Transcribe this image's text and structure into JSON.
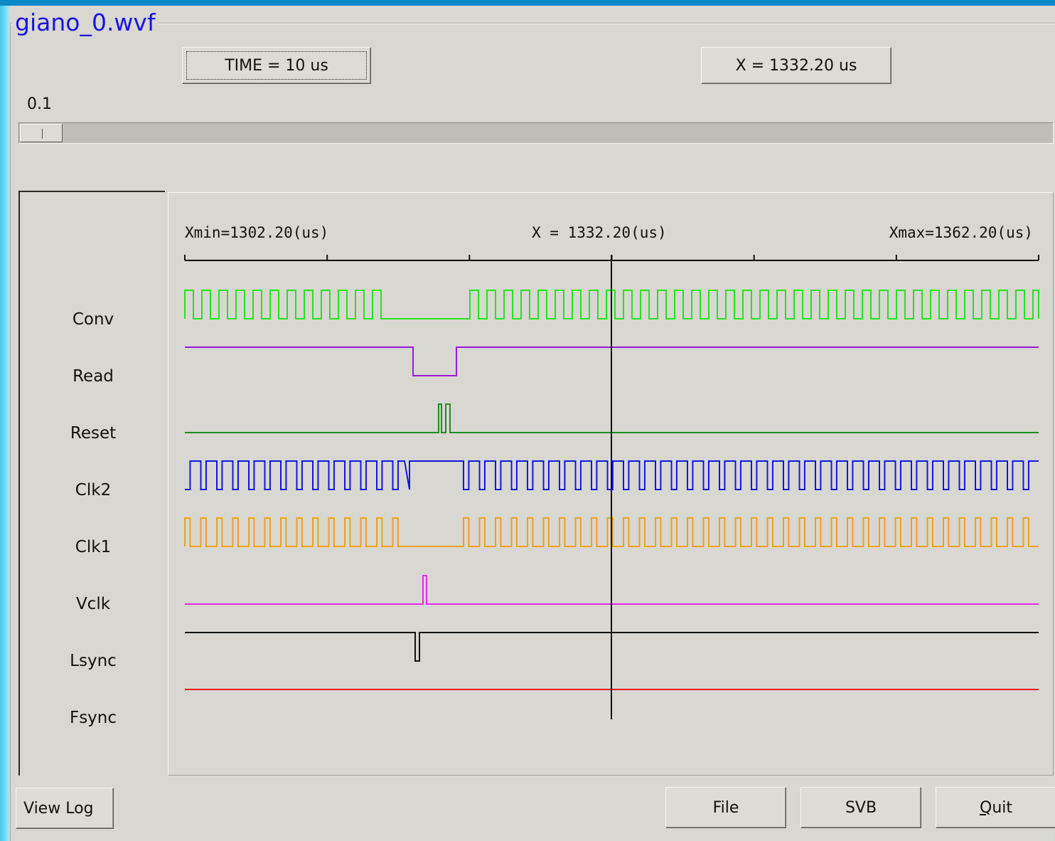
{
  "window": {
    "title": "giano_0.wvf"
  },
  "toolbar": {
    "time_button": "TIME = 10 us",
    "x_button": "X = 1332.20 us",
    "slider_value": "0.1"
  },
  "plot": {
    "xmin_label": "Xmin=1302.20(us)",
    "cursor_label": "X = 1332.20(us)",
    "xmax_label": "Xmax=1362.20(us)"
  },
  "signals": [
    {
      "name": "Conv",
      "color": "#22e41c"
    },
    {
      "name": "Read",
      "color": "#9a18d8"
    },
    {
      "name": "Reset",
      "color": "#1e8e1e"
    },
    {
      "name": "Clk2",
      "color": "#1414e0"
    },
    {
      "name": "Clk1",
      "color": "#f0a018"
    },
    {
      "name": "Vclk",
      "color": "#e828e8"
    },
    {
      "name": "Lsync",
      "color": "#111111"
    },
    {
      "name": "Fsync",
      "color": "#e81818"
    }
  ],
  "buttons": {
    "view_log": "View Log",
    "file": "File",
    "svb": "SVB",
    "quit": "Quit"
  },
  "icons": {
    "slider_thumb": "slider-grip-icon"
  }
}
